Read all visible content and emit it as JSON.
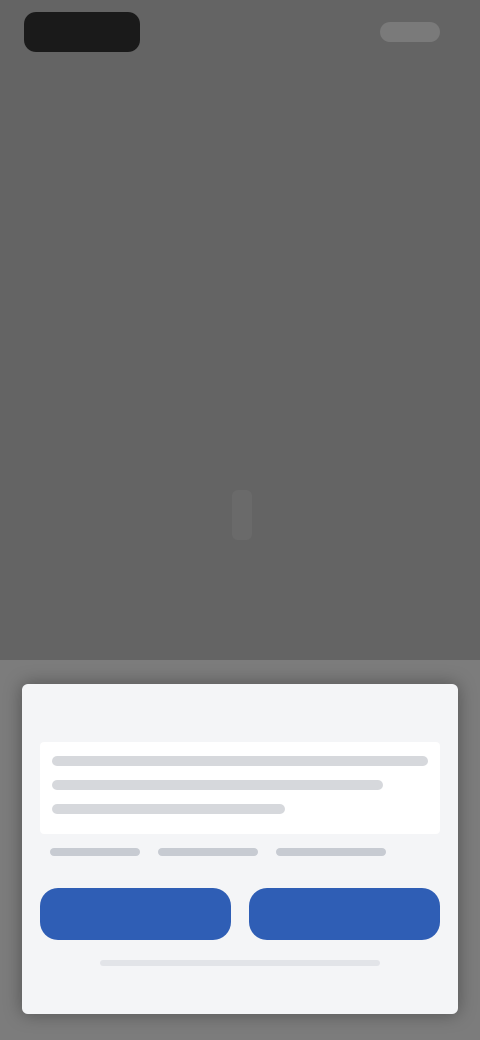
{
  "colors": {
    "background": "#646464",
    "dialog": "#f4f5f7",
    "primary_button": "#2f5eb5"
  },
  "top_bar": {
    "logo_icon": "app-logo"
  },
  "dialog": {
    "title": "",
    "body": "",
    "links": [
      "",
      "",
      ""
    ],
    "buttons": [
      {
        "label": ""
      },
      {
        "label": ""
      }
    ]
  }
}
